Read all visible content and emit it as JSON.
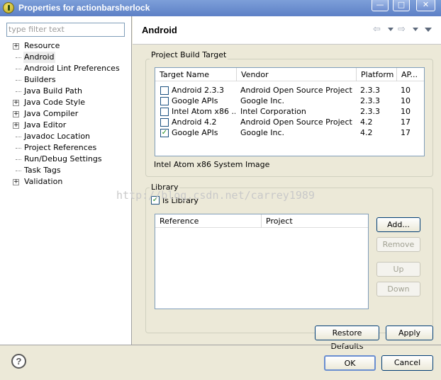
{
  "window": {
    "title": "Properties for actionbarsherlock",
    "min_symbol": "—",
    "max_symbol": "□",
    "close_symbol": "✕"
  },
  "filter": {
    "placeholder": "type filter text"
  },
  "tree": [
    {
      "label": "Resource",
      "expandable": true,
      "selected": false
    },
    {
      "label": "Android",
      "expandable": false,
      "selected": true
    },
    {
      "label": "Android Lint Preferences",
      "expandable": false,
      "selected": false
    },
    {
      "label": "Builders",
      "expandable": false,
      "selected": false
    },
    {
      "label": "Java Build Path",
      "expandable": false,
      "selected": false
    },
    {
      "label": "Java Code Style",
      "expandable": true,
      "selected": false
    },
    {
      "label": "Java Compiler",
      "expandable": true,
      "selected": false
    },
    {
      "label": "Java Editor",
      "expandable": true,
      "selected": false
    },
    {
      "label": "Javadoc Location",
      "expandable": false,
      "selected": false
    },
    {
      "label": "Project References",
      "expandable": false,
      "selected": false
    },
    {
      "label": "Run/Debug Settings",
      "expandable": false,
      "selected": false
    },
    {
      "label": "Task Tags",
      "expandable": false,
      "selected": false
    },
    {
      "label": "Validation",
      "expandable": true,
      "selected": false
    }
  ],
  "page": {
    "title": "Android"
  },
  "build_target": {
    "group_title": "Project Build Target",
    "columns": [
      "Target Name",
      "Vendor",
      "Platform",
      "AP..."
    ],
    "rows": [
      {
        "checked": false,
        "name": "Android 2.3.3",
        "vendor": "Android Open Source Project",
        "platform": "2.3.3",
        "api": "10"
      },
      {
        "checked": false,
        "name": "Google APIs",
        "vendor": "Google Inc.",
        "platform": "2.3.3",
        "api": "10"
      },
      {
        "checked": false,
        "name": "Intel Atom x86 ...",
        "vendor": "Intel Corporation",
        "platform": "2.3.3",
        "api": "10"
      },
      {
        "checked": false,
        "name": "Android 4.2",
        "vendor": "Android Open Source Project",
        "platform": "4.2",
        "api": "17"
      },
      {
        "checked": true,
        "name": "Google APIs",
        "vendor": "Google Inc.",
        "platform": "4.2",
        "api": "17"
      }
    ],
    "description": "Intel Atom x86 System Image"
  },
  "library": {
    "group_title": "Library",
    "is_library_label": "Is Library",
    "is_library_checked": true,
    "columns": [
      "Reference",
      "Project"
    ],
    "buttons": {
      "add": "Add...",
      "remove": "Remove",
      "up": "Up",
      "down": "Down"
    }
  },
  "watermark": "http://blog.csdn.net/carrey1989",
  "buttons": {
    "restore_defaults": "Restore Defaults",
    "apply": "Apply",
    "ok": "OK",
    "cancel": "Cancel",
    "help": "?"
  }
}
